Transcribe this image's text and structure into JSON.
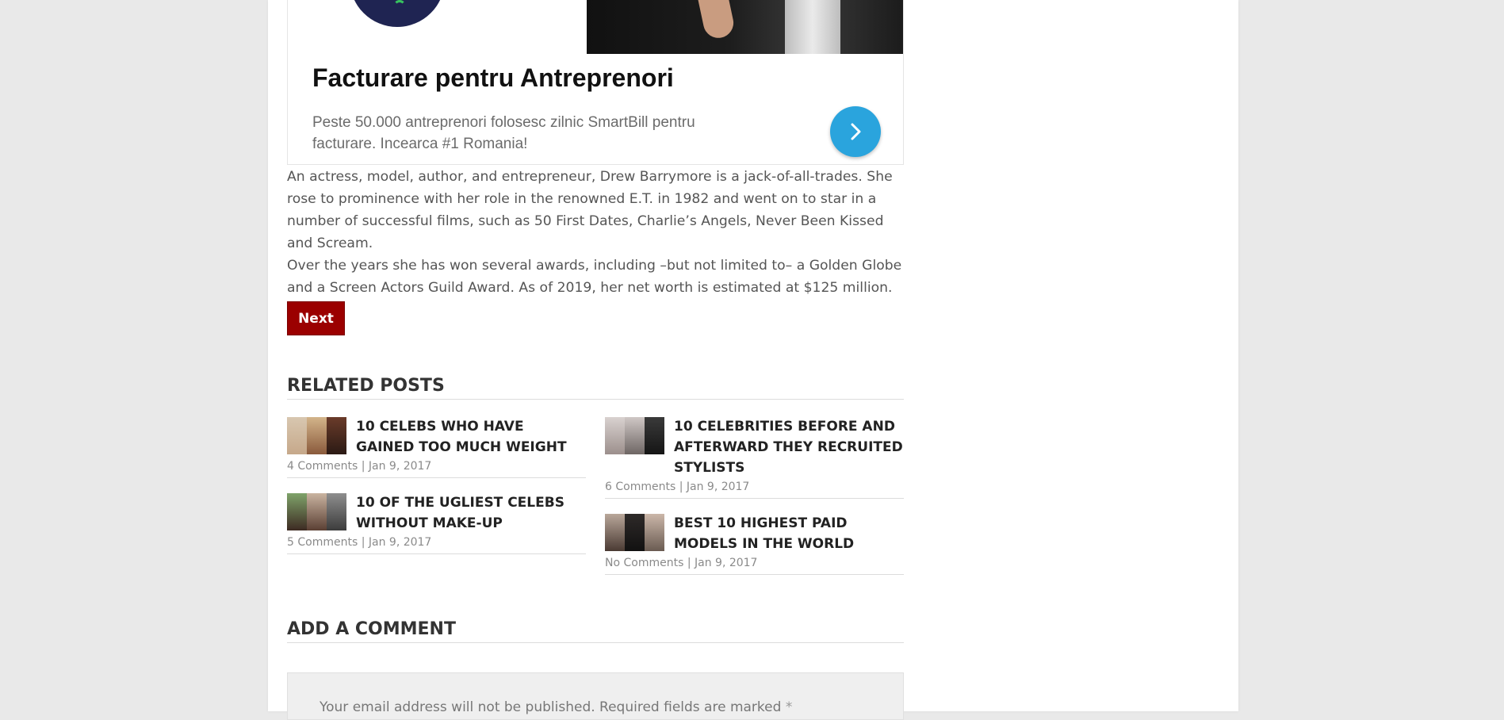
{
  "ad": {
    "title": "Facturare pentru Antreprenori",
    "description": "Peste 50.000 antreprenori folosesc zilnic SmartBill pentru facturare. Incearca #1 Romania!",
    "arrow_icon": "chevron-right-icon",
    "accent_color": "#2aa4dd"
  },
  "article": {
    "paragraph1": "An actress, model, author, and entrepreneur, Drew Barrymore is a jack-of-all-trades. She rose to prominence with her role in the renowned E.T. in 1982 and went on to star in a number of successful films, such as 50 First Dates, Charlie’s Angels, Never Been Kissed and Scream.",
    "paragraph2": "Over the years she has won several awards, including –but not limited to– a Golden Globe and a Screen Actors Guild Award. As of 2019, her net worth is estimated at $125 million."
  },
  "pagination": {
    "next_label": "Next",
    "color": "#9b0000"
  },
  "related": {
    "heading": "RELATED POSTS",
    "left": [
      {
        "title": "10 CELEBS WHO HAVE GAINED TOO MUCH WEIGHT",
        "comments": "4 Comments",
        "date": "Jan 9, 2017"
      },
      {
        "title": "10 OF THE UGLIEST CELEBS WITHOUT MAKE-UP",
        "comments": "5 Comments",
        "date": "Jan 9, 2017"
      }
    ],
    "right": [
      {
        "title": "10 CELEBRITIES BEFORE AND AFTERWARD THEY RECRUITED STYLISTS",
        "comments": "6 Comments",
        "date": "Jan 9, 2017"
      },
      {
        "title": "BEST 10 HIGHEST PAID MODELS IN THE WORLD",
        "comments": "No Comments",
        "date": "Jan 9, 2017"
      }
    ],
    "separator": "|"
  },
  "comments": {
    "heading": "ADD A COMMENT",
    "note": "Your email address will not be published. Required fields are marked",
    "required_mark": "*"
  }
}
